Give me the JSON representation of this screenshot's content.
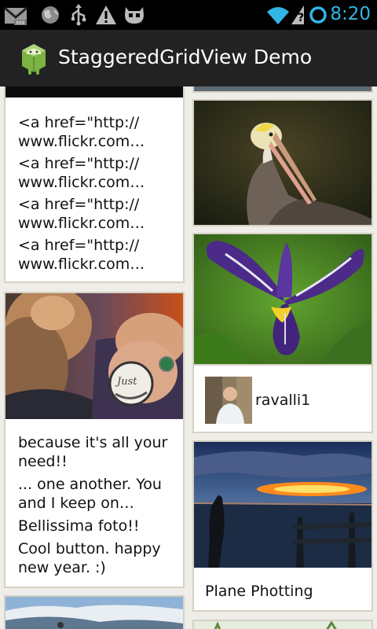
{
  "status_bar": {
    "time": "8:20",
    "icons": [
      "gmail-icon",
      "earth-icon",
      "usb-icon",
      "warning-icon",
      "cyanogen-icon",
      "wifi-icon",
      "signal-unknown-icon",
      "battery-icon"
    ]
  },
  "action_bar": {
    "title": "StaggeredGridView Demo",
    "icon": "android-icon"
  },
  "grid": {
    "card_links": {
      "lines": [
        [
          "<a href=\"http://",
          "www.flickr.com…"
        ],
        [
          "<a href=\"http://",
          "www.flickr.com…"
        ],
        [
          "<a href=\"http://",
          "www.flickr.com…"
        ],
        [
          "<a href=\"http://",
          "www.flickr.com…"
        ]
      ]
    },
    "card_button": {
      "lines": [
        [
          "because it's all your",
          "need!!"
        ],
        [
          "... one another. You",
          "and I keep on…"
        ],
        [
          "Bellissima foto!!"
        ],
        [
          "Cool button. happy",
          "new year. :)"
        ]
      ]
    },
    "card_iris": {
      "username": "ravalli1"
    },
    "card_sunset": {
      "caption": "Plane Photting"
    }
  },
  "colors": {
    "status_bar": "#000000",
    "action_bar": "#222222",
    "clock": "#33b5e5",
    "card_border": "#d6d1c4",
    "background": "#eeede8"
  }
}
